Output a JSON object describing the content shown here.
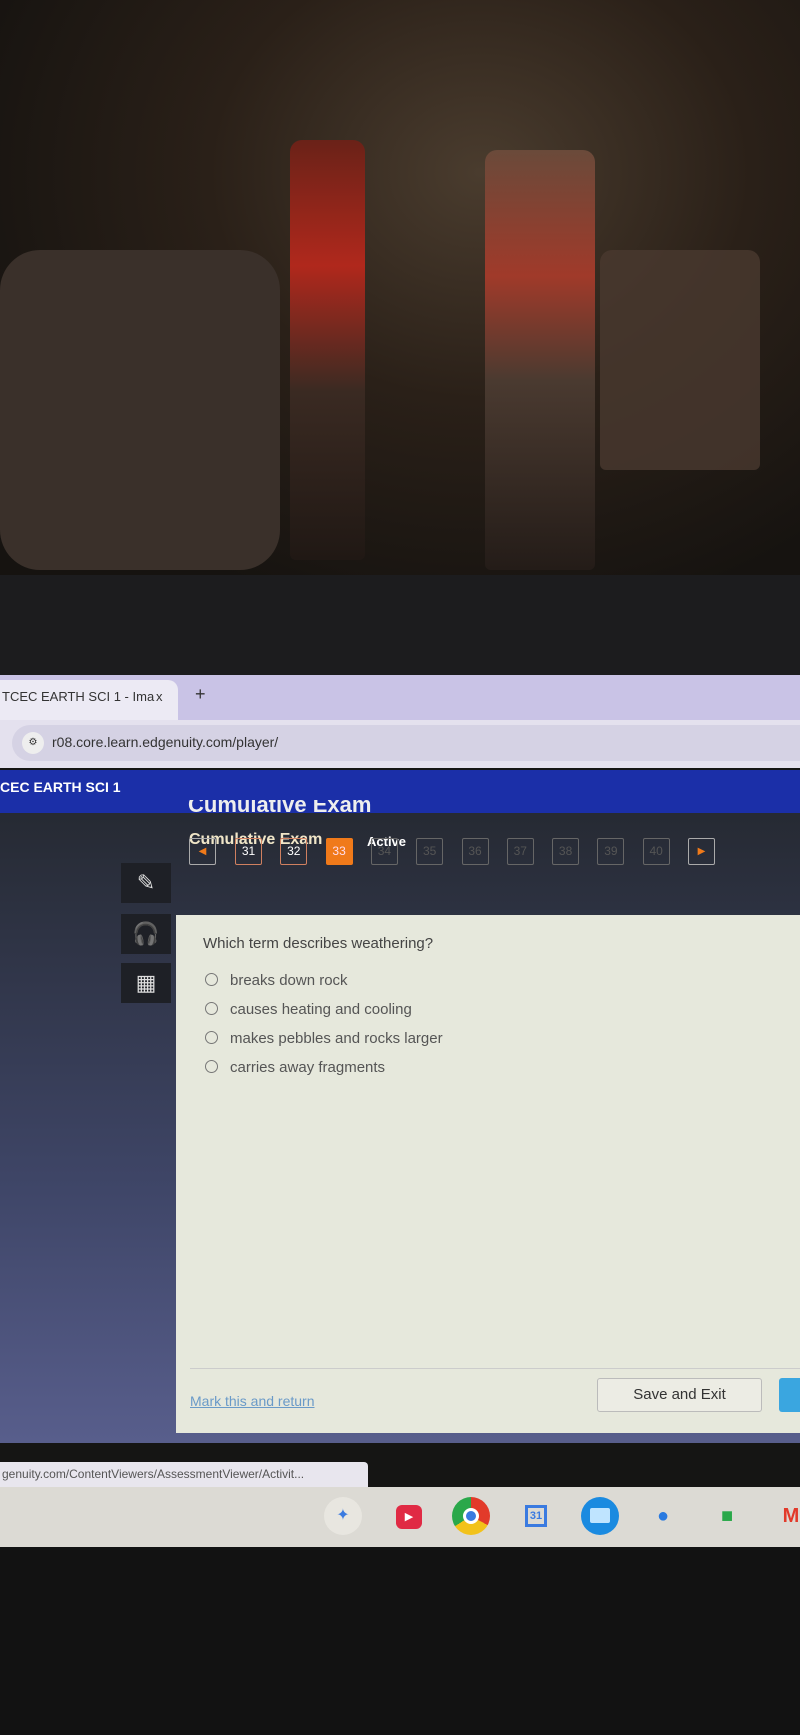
{
  "browser": {
    "tab_title": "TCEC EARTH SCI 1 - Ima",
    "tab_close": "x",
    "new_tab": "+",
    "url": "r08.core.learn.edgenuity.com/player/",
    "status_url": "genuity.com/ContentViewers/AssessmentViewer/Activit..."
  },
  "header": {
    "course": "CEC EARTH SCI 1"
  },
  "exam": {
    "title_big": "Cumulative Exam",
    "subtitle": "Cumulative Exam",
    "status": "Active",
    "current_question": 33,
    "questions": [
      {
        "num": "31",
        "state": "answered"
      },
      {
        "num": "32",
        "state": "answered"
      },
      {
        "num": "33",
        "state": "current"
      },
      {
        "num": "34",
        "state": "unvisited"
      },
      {
        "num": "35",
        "state": "unvisited"
      },
      {
        "num": "36",
        "state": "unvisited"
      },
      {
        "num": "37",
        "state": "unvisited"
      },
      {
        "num": "38",
        "state": "unvisited"
      },
      {
        "num": "39",
        "state": "unvisited"
      },
      {
        "num": "40",
        "state": "unvisited"
      }
    ],
    "prev_icon": "◀",
    "next_icon": "▶",
    "accent_color": "#f07a1a"
  },
  "tools": [
    "pencil-icon",
    "headphones-icon",
    "calculator-icon"
  ],
  "question": {
    "text": "Which term describes weathering?",
    "options": [
      "breaks down rock",
      "causes heating and cooling",
      "makes pebbles and rocks larger",
      "carries away fragments"
    ]
  },
  "footer": {
    "mark_link": "Mark this and return",
    "save_exit": "Save and Exit"
  },
  "shelf": {
    "calendar_day": "31",
    "apps": [
      "gemini-icon",
      "youtube-icon",
      "chrome-icon",
      "calendar-icon",
      "files-icon",
      "chat-icon",
      "meet-icon",
      "gmail-icon"
    ]
  }
}
